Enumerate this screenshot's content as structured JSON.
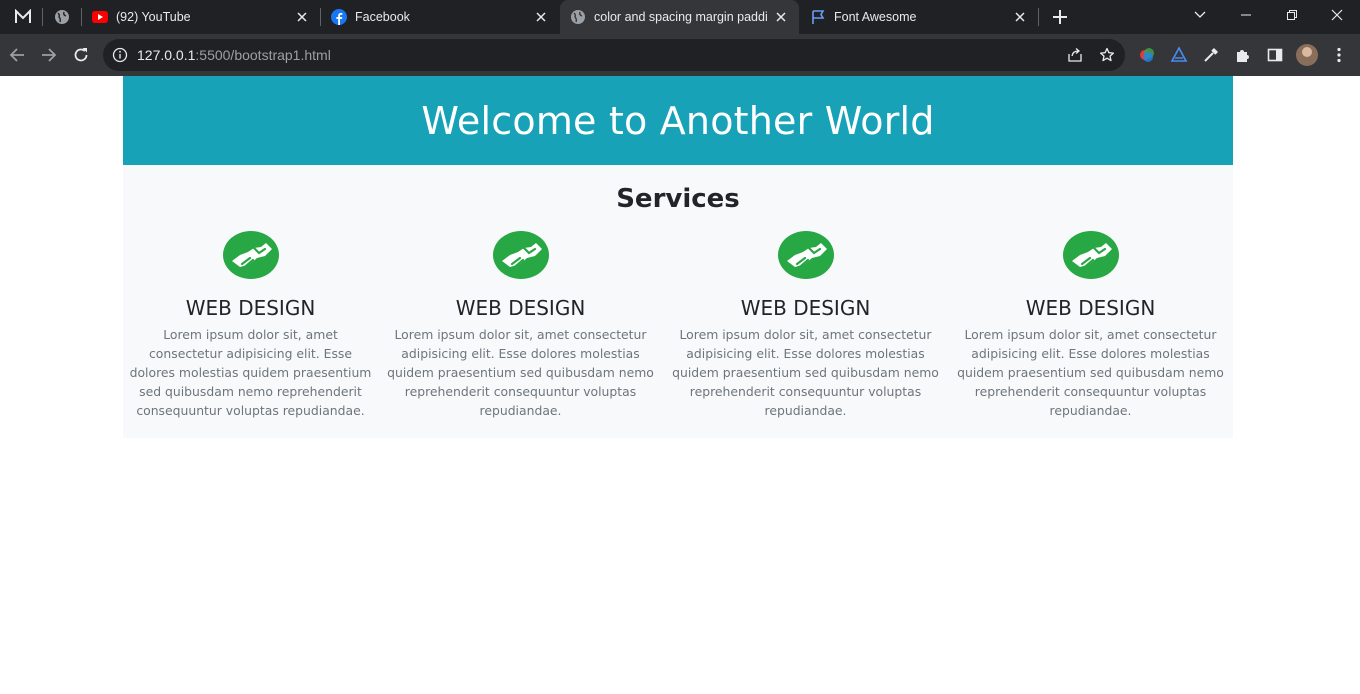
{
  "browser": {
    "tabs": [
      {
        "title": "(92) YouTube",
        "icon": "youtube-icon"
      },
      {
        "title": "Facebook",
        "icon": "facebook-icon"
      },
      {
        "title": "color and spacing margin paddin",
        "icon": "globe-icon",
        "active": true
      },
      {
        "title": "Font Awesome",
        "icon": "flag-icon"
      }
    ],
    "url_host": "127.0.0.1",
    "url_path": ":5500/bootstrap1.html"
  },
  "page": {
    "heading": "Welcome to Another World",
    "section_title": "Services",
    "services": [
      {
        "title": "WEB DESIGN",
        "text": "Lorem ipsum dolor sit, amet consectetur adipisicing elit. Esse dolores molestias quidem praesentium sed quibusdam nemo reprehenderit consequuntur voluptas repudiandae.",
        "icon": "handshake-icon"
      },
      {
        "title": "WEB DESIGN",
        "text": "Lorem ipsum dolor sit, amet consectetur adipisicing elit. Esse dolores molestias quidem praesentium sed quibusdam nemo reprehenderit consequuntur voluptas repudiandae.",
        "icon": "handshake-icon"
      },
      {
        "title": "WEB DESIGN",
        "text": "Lorem ipsum dolor sit, amet consectetur adipisicing elit. Esse dolores molestias quidem praesentium sed quibusdam nemo reprehenderit consequuntur voluptas repudiandae.",
        "icon": "handshake-icon"
      },
      {
        "title": "WEB DESIGN",
        "text": "Lorem ipsum dolor sit, amet consectetur adipisicing elit. Esse dolores molestias quidem praesentium sed quibusdam nemo reprehenderit consequuntur voluptas repudiandae.",
        "icon": "handshake-icon"
      }
    ]
  },
  "colors": {
    "hero_bg": "#17a2b8",
    "services_bg": "#f8f9fa",
    "icon_green": "#28a745",
    "chrome_dark": "#202124",
    "chrome_toolbar": "#35363a"
  }
}
